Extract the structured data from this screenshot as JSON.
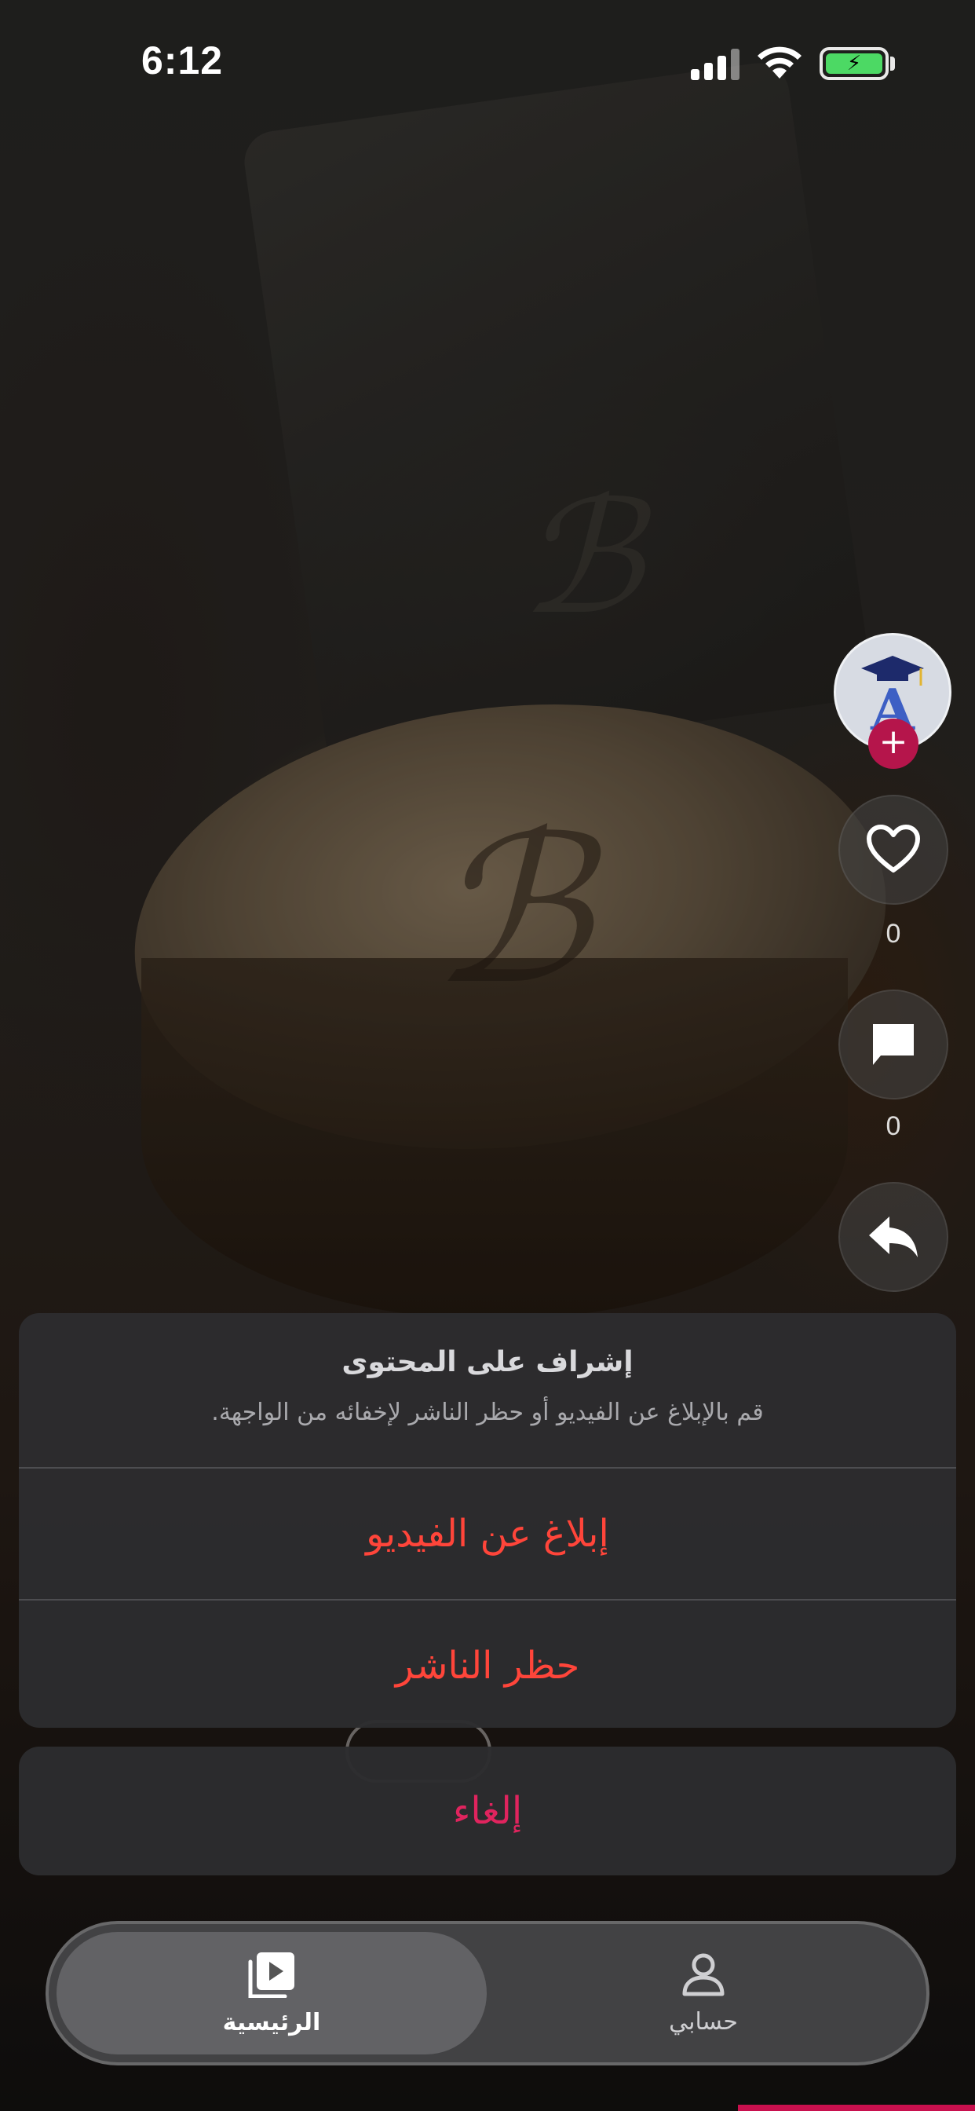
{
  "status_bar": {
    "time": "6:12",
    "signal_icon": "cellular-signal-icon",
    "wifi_icon": "wifi-icon",
    "battery_icon": "battery-charging-icon",
    "battery_color": "#4cd964"
  },
  "right_rail": {
    "avatar_letter": "A",
    "follow_symbol": "+",
    "like": {
      "icon": "heart-icon",
      "count": "0"
    },
    "comment": {
      "icon": "comment-icon",
      "count": "0"
    },
    "share": {
      "icon": "share-icon"
    }
  },
  "action_sheet": {
    "title": "إشراف على المحتوى",
    "message": "قم بالإبلاغ عن الفيديو أو حظر الناشر لإخفائه من الواجهة.",
    "actions": [
      {
        "label": "إبلاغ عن الفيديو",
        "color": "#ff453a"
      },
      {
        "label": "حظر الناشر",
        "color": "#ff453a"
      }
    ],
    "cancel_label": "إلغاء",
    "cancel_color": "#e0245e"
  },
  "tab_bar": {
    "tabs": [
      {
        "label": "الرئيسية",
        "icon": "video-play-icon",
        "active": true
      },
      {
        "label": "حسابي",
        "icon": "person-icon",
        "active": false
      }
    ]
  }
}
